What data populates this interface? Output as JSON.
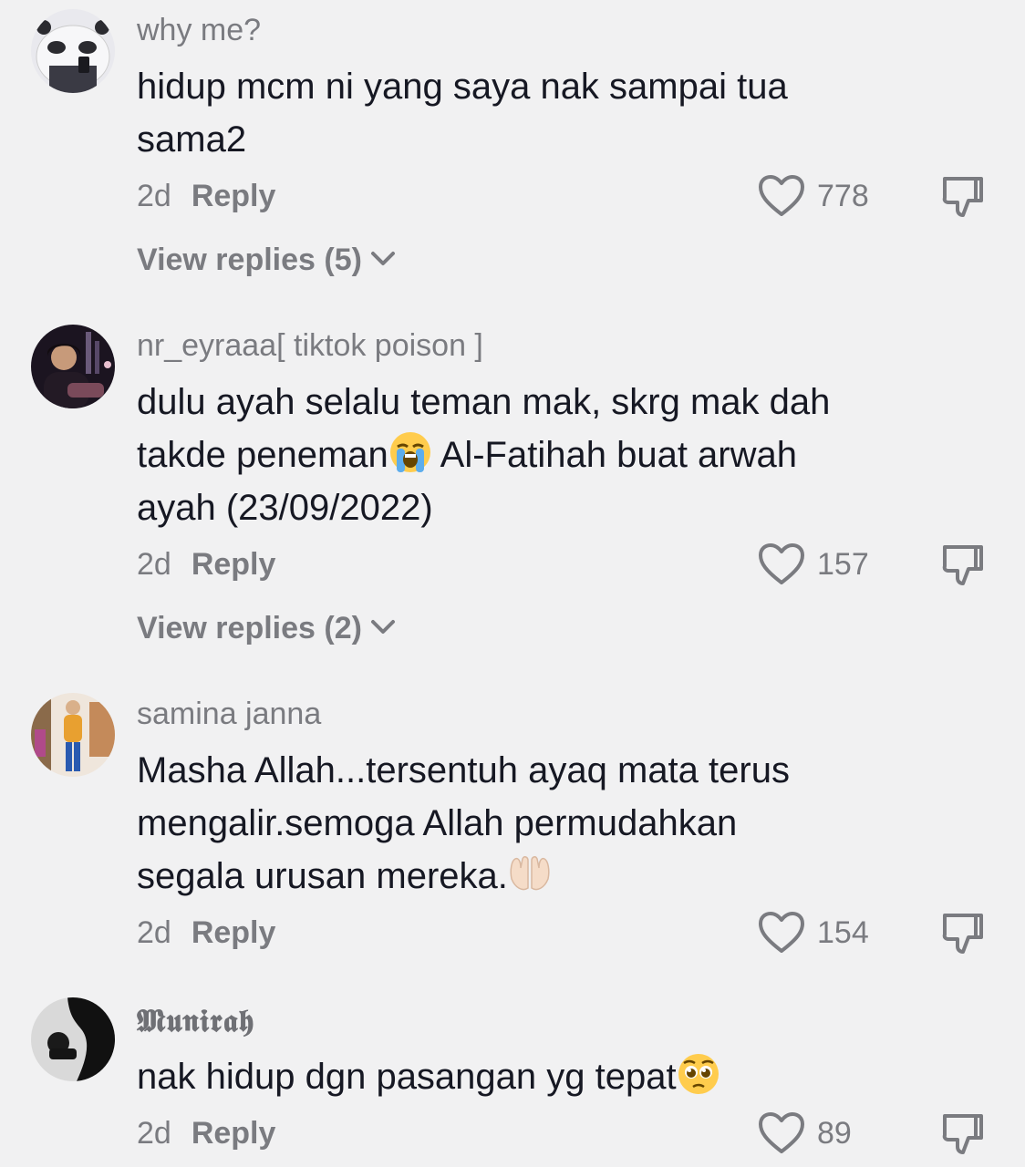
{
  "comments": [
    {
      "username": "why me?",
      "text_lines": [
        "hidup mcm ni yang saya nak sampai tua",
        "sama2"
      ],
      "time": "2d",
      "reply_label": "Reply",
      "likes": "778",
      "view_replies": "View replies (5)"
    },
    {
      "username": "nr_eyraaa[ tiktok poison ]",
      "text_line1": "dulu ayah selalu teman mak, skrg mak dah",
      "text_line2_a": "takde peneman",
      "text_line2_b": " Al-Fatihah buat arwah",
      "text_line3": "ayah (23/09/2022)",
      "emoji": "loudly-crying-face-emoji",
      "time": "2d",
      "reply_label": "Reply",
      "likes": "157",
      "view_replies": "View replies (2)"
    },
    {
      "username": "samina janna",
      "text_line1": "Masha Allah...tersentuh ayaq mata terus",
      "text_line2": "mengalir.semoga Allah permudahkan",
      "text_line3": "segala urusan mereka.",
      "emoji": "palms-up-together-emoji",
      "time": "2d",
      "reply_label": "Reply",
      "likes": "154"
    },
    {
      "username": "𝕸𝖚𝖓𝖎𝖗𝖆𝖍",
      "text": "nak hidup dgn pasangan yg tepat",
      "emoji": "pleading-face-emoji",
      "time": "2d",
      "reply_label": "Reply",
      "likes": "89"
    }
  ],
  "colors": {
    "background": "#f1f1f2",
    "text": "#161823",
    "secondary": "#7a7b80"
  }
}
